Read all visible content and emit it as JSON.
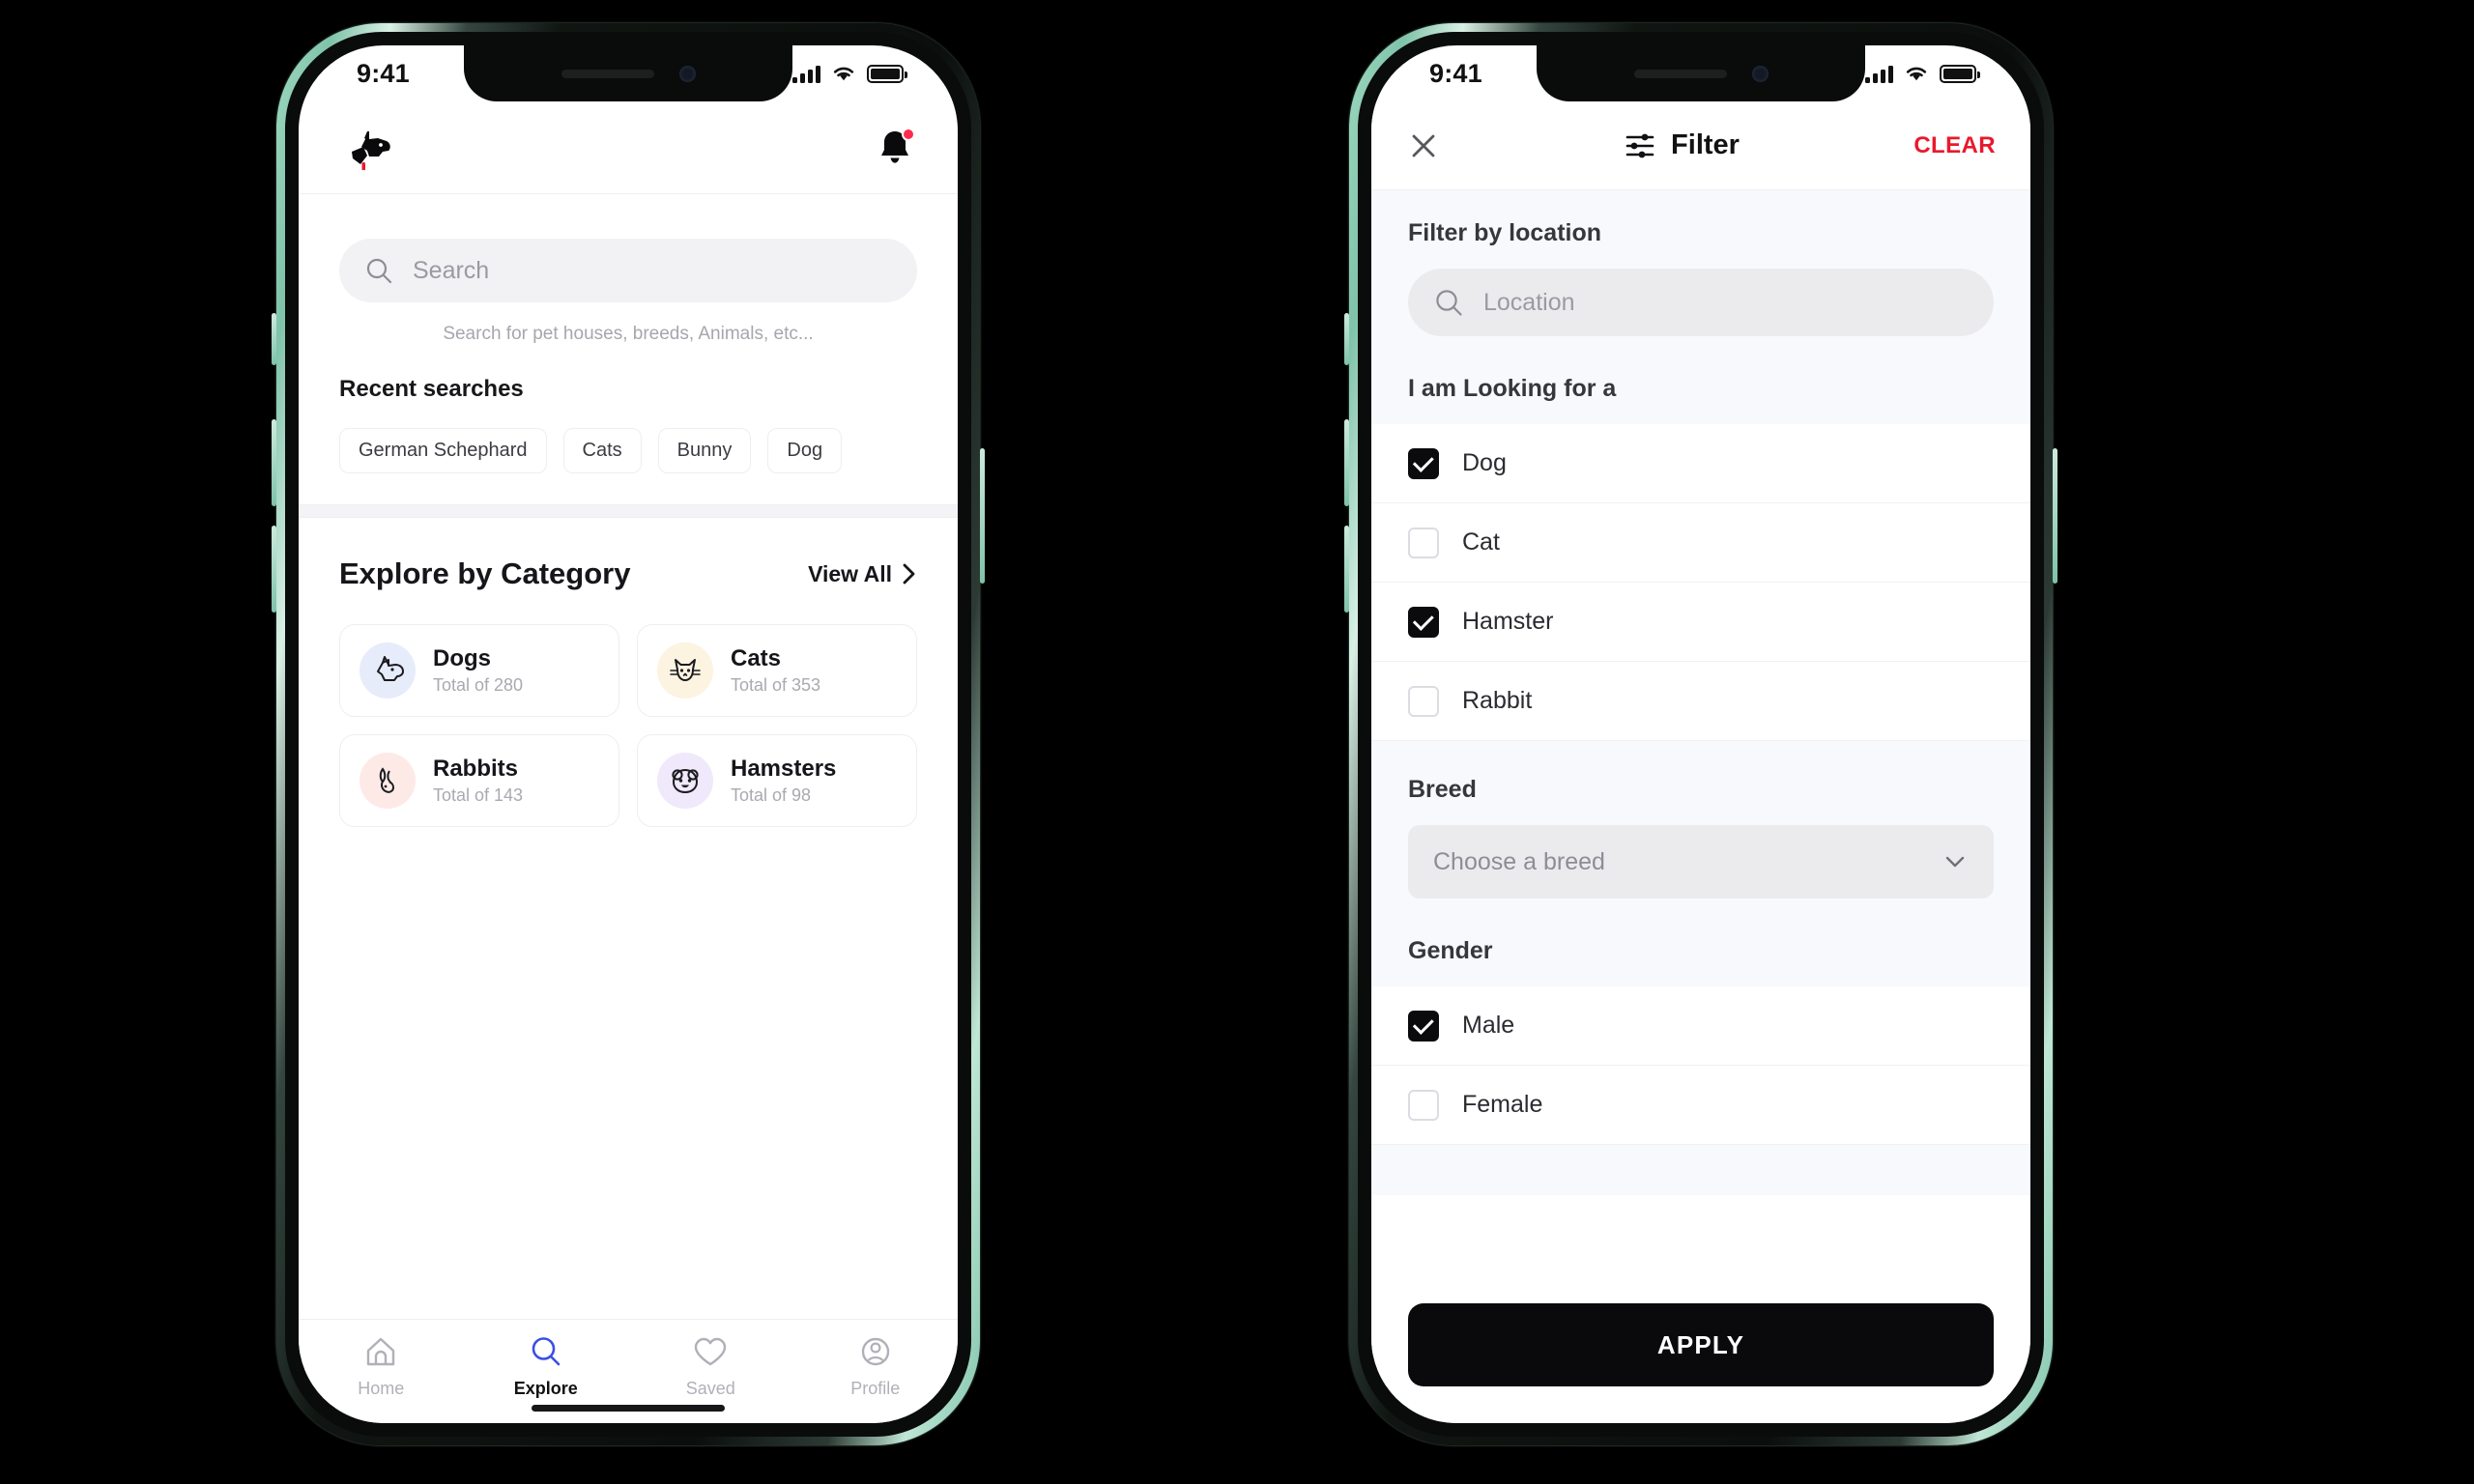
{
  "theme": {
    "background": "#000000",
    "frame_edge": "#8ecdb4",
    "accent_red": "#e8192c",
    "accent_blue": "#3b4fe4",
    "ink": "#111114"
  },
  "left_phone": {
    "status": {
      "time": "9:41",
      "signal_icon": "signal-bars-icon",
      "wifi_icon": "wifi-icon",
      "battery_icon": "battery-full-icon"
    },
    "header": {
      "logo_icon": "dog-head-logo-icon",
      "bell_icon": "notification-bell-icon",
      "bell_badge": ""
    },
    "search": {
      "placeholder": "Search",
      "value": "",
      "icon": "search-icon",
      "hint": "Search for pet houses, breeds, Animals, etc..."
    },
    "recent": {
      "title": "Recent searches",
      "chips": [
        "German Schephard",
        "Cats",
        "Bunny",
        "Dog"
      ]
    },
    "category": {
      "title": "Explore by Category",
      "view_all": "View All",
      "chevron_icon": "chevron-right-icon",
      "items": [
        {
          "name": "Dogs",
          "subtitle": "Total of 280",
          "icon": "dog-icon",
          "bg": "#e7ecfb"
        },
        {
          "name": "Cats",
          "subtitle": "Total of 353",
          "icon": "cat-icon",
          "bg": "#fcf3e0"
        },
        {
          "name": "Rabbits",
          "subtitle": "Total of 143",
          "icon": "rabbit-icon",
          "bg": "#fdeae6"
        },
        {
          "name": "Hamsters",
          "subtitle": "Total of 98",
          "icon": "hamster-icon",
          "bg": "#f0e8fb"
        }
      ]
    },
    "tabbar": [
      {
        "label": "Home",
        "icon": "home-icon",
        "active": false
      },
      {
        "label": "Explore",
        "icon": "search-icon",
        "active": true
      },
      {
        "label": "Saved",
        "icon": "heart-icon",
        "active": false
      },
      {
        "label": "Profile",
        "icon": "user-circle-icon",
        "active": false
      }
    ]
  },
  "right_phone": {
    "status": {
      "time": "9:41",
      "signal_icon": "signal-bars-icon",
      "wifi_icon": "wifi-icon",
      "battery_icon": "battery-full-icon"
    },
    "header": {
      "close_icon": "close-x-icon",
      "filter_icon": "sliders-filter-icon",
      "title": "Filter",
      "clear_label": "CLEAR",
      "clear_color": "#e8192c"
    },
    "location": {
      "section_title": "Filter by location",
      "placeholder": "Location",
      "value": "",
      "icon": "search-icon"
    },
    "looking_for": {
      "section_title": "I am Looking for a",
      "options": [
        {
          "label": "Dog",
          "checked": true
        },
        {
          "label": "Cat",
          "checked": false
        },
        {
          "label": "Hamster",
          "checked": true
        },
        {
          "label": "Rabbit",
          "checked": false
        }
      ]
    },
    "breed": {
      "section_title": "Breed",
      "selected": "Choose a breed",
      "chevron_icon": "chevron-down-icon"
    },
    "gender": {
      "section_title": "Gender",
      "options": [
        {
          "label": "Male",
          "checked": true
        },
        {
          "label": "Female",
          "checked": false
        }
      ]
    },
    "apply": {
      "label": "APPLY"
    }
  }
}
